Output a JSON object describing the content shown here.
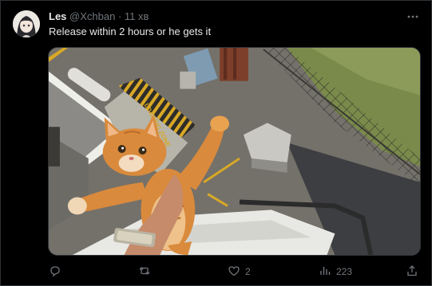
{
  "tweet": {
    "author_name": "Les",
    "author_handle": "@Xchban",
    "separator": "·",
    "time": "11 хв",
    "text": "Release within 2 hours or he gets it",
    "media_sign_text": "LOADING ZONE"
  },
  "actions": {
    "reply_count": "",
    "retweet_count": "",
    "like_count": "2",
    "views_count": "223"
  },
  "icons": {
    "more": "more-icon",
    "reply": "reply-icon",
    "retweet": "retweet-icon",
    "like": "heart-icon",
    "views": "bar-chart-icon",
    "share": "share-icon"
  },
  "colors": {
    "background": "#000000",
    "text": "#e7e9ea",
    "muted": "#71767b",
    "border": "#2f3336"
  }
}
